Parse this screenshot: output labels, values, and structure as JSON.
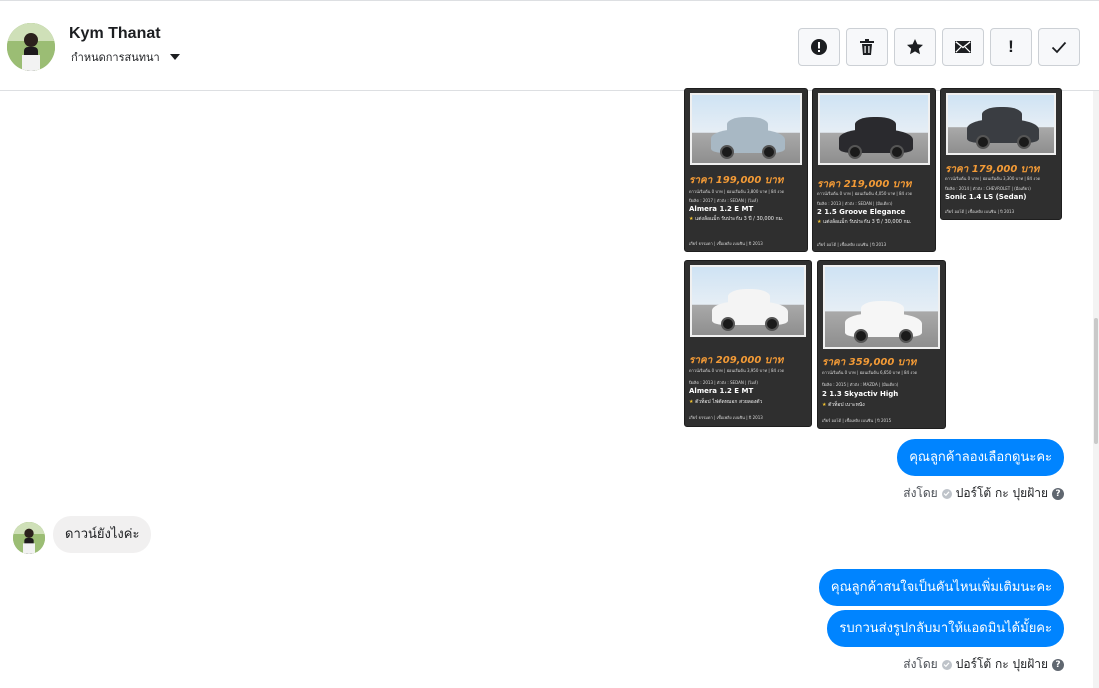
{
  "header": {
    "contact_name": "Kym Thanat",
    "assign_label": "กำหนดการสนทนา",
    "actions": [
      {
        "name": "spam-button",
        "icon": "alert-circle-icon"
      },
      {
        "name": "delete-button",
        "icon": "trash-icon"
      },
      {
        "name": "star-button",
        "icon": "star-icon"
      },
      {
        "name": "unread-button",
        "icon": "envelope-icon"
      },
      {
        "name": "follow-up-button",
        "icon": "exclamation-icon",
        "text": "!"
      },
      {
        "name": "done-button",
        "icon": "check-icon"
      }
    ]
  },
  "cards": [
    {
      "price": "ราคา 199,000 บาท",
      "fine1": "ดาวน์เริ่มต้น 0 บาท | ผ่อนเริ่มต้น 3,800 บาท | 84 งวด",
      "fine2": "ปีผลิต : 2017 | ตัวถัง : SEDAN | (ไมล์)",
      "model": "Almera 1.2 E MT",
      "feature": "แต่งล้อแม็ก รับประกัน 3 ปี / 30,000 กม.",
      "foot": "เกียร์ ธรรมดา | เชื้อเพลิง เบนซิน | ปี 2013",
      "car_color": "#a8b8c4"
    },
    {
      "price": "ราคา 219,000 บาท",
      "fine1": "ดาวน์เริ่มต้น 0 บาท | ผ่อนเริ่มต้น 4,050 บาท | 84 งวด",
      "fine2": "ปีผลิต : 2013 | ตัวถัง : SEDAN | (มือเดียว)",
      "model": "2 1.5 Groove Elegance",
      "feature": "แต่งล้อแม็ก รับประกัน 3 ปี / 30,000 กม.",
      "foot": "เกียร์ ออโต้ | เชื้อเพลิง เบนซิน | ปี 2013",
      "car_color": "#2a2a2e"
    },
    {
      "price": "ราคา 179,000 บาท",
      "fine1": "ดาวน์เริ่มต้น 0 บาท | ผ่อนเริ่มต้น 3,300 บาท | 84 งวด",
      "fine2": "ปีผลิต : 2014 | ตัวถัง : CHEVROLET | (มือเดียว)",
      "model": "Sonic 1.4 LS (Sedan)",
      "feature": "",
      "foot": "เกียร์ ออโต้ | เชื้อเพลิง เบนซิน | ปี 2013",
      "car_color": "#3a3d42"
    },
    {
      "price": "ราคา 209,000 บาท",
      "fine1": "ดาวน์เริ่มต้น 0 บาท | ผ่อนเริ่มต้น 3,950 บาท | 84 งวด",
      "fine2": "ปีผลิต : 2013 | ตัวถัง : SEDAN | (ไมล์)",
      "model": "Almera 1.2 E MT",
      "feature": "ตัวท็อป ไฟตัดหมอก สวยลองตัว",
      "foot": "เกียร์ ธรรมดา | เชื้อเพลิง เบนซิน | ปี 2013",
      "car_color": "#f4f4f4"
    },
    {
      "price": "ราคา 359,000 บาท",
      "fine1": "ดาวน์เริ่มต้น 0 บาท | ผ่อนเริ่มต้น 6,650 บาท | 84 งวด",
      "fine2": "ปีผลิต : 2015 | ตัวถัง : MAZDA | (มือเดียว)",
      "model": "2 1.3 Skyactiv High",
      "feature": "ตัวท็อป เบาะหนัง",
      "foot": "เกียร์ ออโต้ | เชื้อเพลิง เบนซิน | ปี 2015",
      "car_color": "#f6f6f6"
    }
  ],
  "messages": {
    "out1": "คุณลูกค้าลองเลือกดูนะคะ",
    "in1": "ดาวน์ยังไงค่ะ",
    "out2": "คุณลูกค้าสนใจเป็นคันไหนเพิ่มเติมนะคะ",
    "out3": "รบกวนส่งรูปกลับมาให้แอดมินได้มั้ยคะ"
  },
  "sent_by": {
    "label": "ส่งโดย",
    "sender": "ปอร์โต้ กะ ปุยฝ้าย",
    "help": "?"
  }
}
